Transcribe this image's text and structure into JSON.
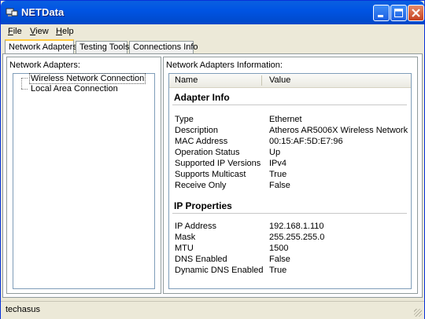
{
  "window": {
    "title": "NETData"
  },
  "menu": [
    "File",
    "View",
    "Help"
  ],
  "tabs": [
    "Network Adapters",
    "Testing Tools",
    "Connections Info"
  ],
  "left_panel": {
    "label": "Network Adapters:",
    "items": [
      "Wireless Network Connection",
      "Local Area Connection"
    ]
  },
  "right_panel": {
    "label": "Network Adapters Information:",
    "columns": [
      "Name",
      "Value"
    ],
    "groups": [
      {
        "title": "Adapter Info",
        "rows": [
          [
            "Type",
            "Ethernet"
          ],
          [
            "Description",
            "Atheros AR5006X Wireless Network ..."
          ],
          [
            "MAC Address",
            "00:15:AF:5D:E7:96"
          ],
          [
            "Operation Status",
            "Up"
          ],
          [
            "Supported IP Versions",
            "IPv4"
          ],
          [
            "Supports Multicast",
            "True"
          ],
          [
            "Receive Only",
            "False"
          ]
        ]
      },
      {
        "title": "IP Properties",
        "rows": [
          [
            "IP Address",
            "192.168.1.110"
          ],
          [
            "Mask",
            "255.255.255.0"
          ],
          [
            "MTU",
            "1500"
          ],
          [
            "DNS Enabled",
            "False"
          ],
          [
            "Dynamic DNS Enabled",
            "True"
          ]
        ]
      }
    ]
  },
  "status": {
    "text": "techasus"
  }
}
